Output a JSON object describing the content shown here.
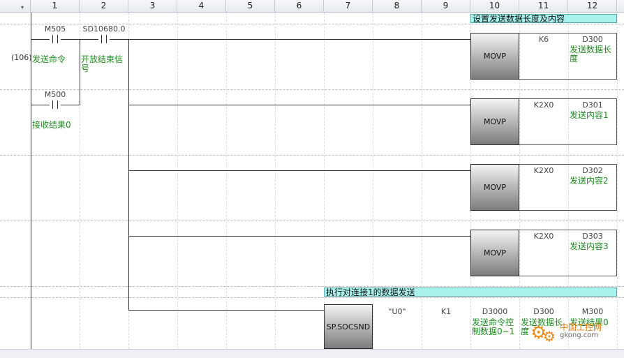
{
  "header": {
    "columns": [
      "1",
      "2",
      "3",
      "4",
      "5",
      "6",
      "7",
      "8",
      "9",
      "10",
      "11",
      "12"
    ]
  },
  "rung": {
    "step_number": "(106)",
    "comment_banner": "设置发送数据长度及内容",
    "contacts": [
      {
        "device": "M505",
        "comment": "发送命令"
      },
      {
        "device": "SD10680.0",
        "comment": "开放结束信号"
      },
      {
        "device": "M500",
        "comment": "接收结果0"
      }
    ],
    "movp": [
      {
        "instr": "MOVP",
        "src": "K6",
        "dst": "D300",
        "dst_comment": "发送数据长度"
      },
      {
        "instr": "MOVP",
        "src": "K2X0",
        "dst": "D301",
        "dst_comment": "发送内容1"
      },
      {
        "instr": "MOVP",
        "src": "K2X0",
        "dst": "D302",
        "dst_comment": "发送内容2"
      },
      {
        "instr": "MOVP",
        "src": "K2X0",
        "dst": "D303",
        "dst_comment": "发送内容3"
      }
    ],
    "socsnd_banner": "执行对连接1的数据发送",
    "socsnd": {
      "instr": "SP.SOCSND",
      "op1": "\"U0\"",
      "op2": "K1",
      "op3": "D3000",
      "op3_comment": "发送命令控制数据0~1",
      "op4": "D300",
      "op4_comment": "发送数据长度",
      "op5": "M300",
      "op5_comment": "发送结果0"
    }
  },
  "watermark": {
    "text1": "中国工控网",
    "text2": "gkong.com"
  }
}
